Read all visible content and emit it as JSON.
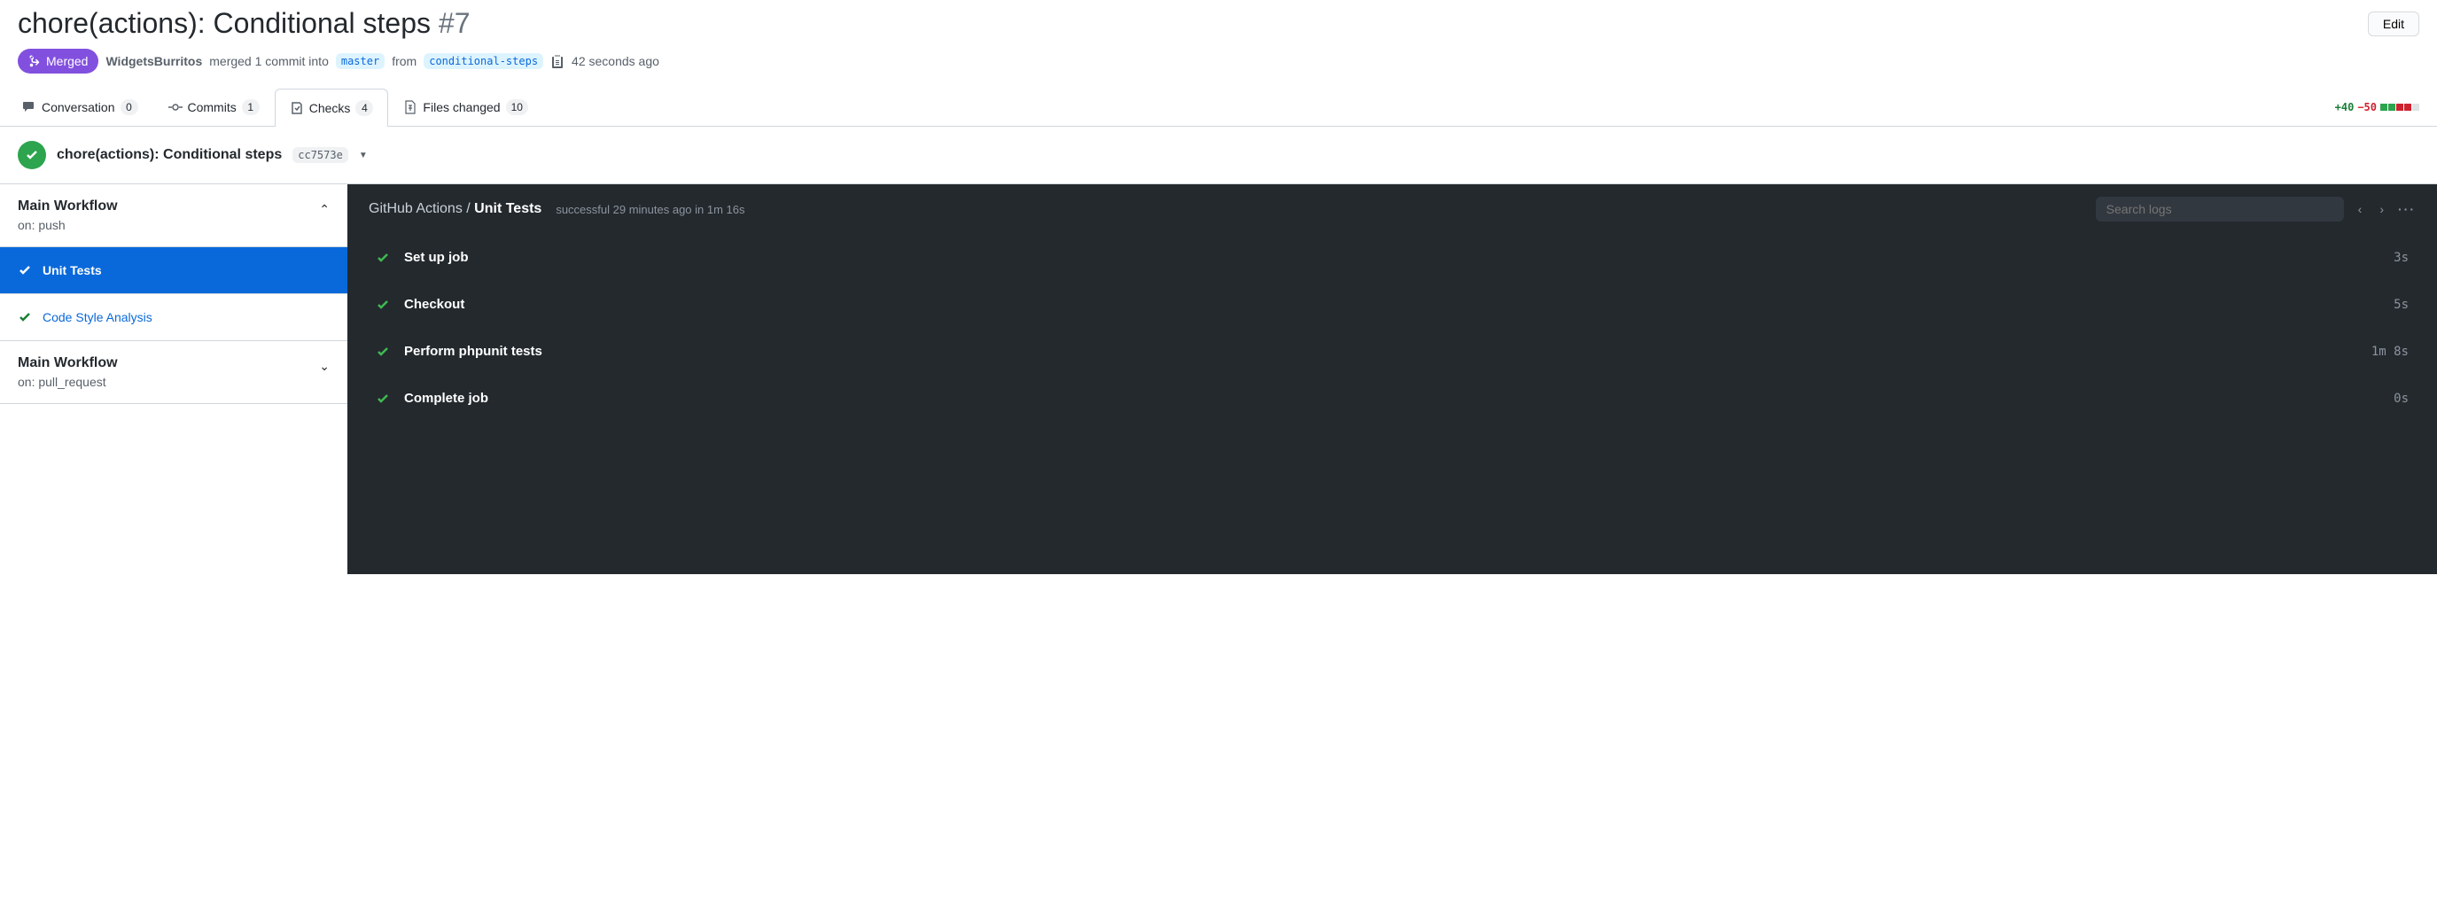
{
  "header": {
    "title": "chore(actions): Conditional steps",
    "number": "#7",
    "edit_label": "Edit",
    "state": "Merged",
    "author": "WidgetsBurritos",
    "merged_text": "merged 1 commit into",
    "base_branch": "master",
    "from_text": "from",
    "head_branch": "conditional-steps",
    "time_ago": "42 seconds ago"
  },
  "tabs": {
    "conversation": {
      "label": "Conversation",
      "count": "0"
    },
    "commits": {
      "label": "Commits",
      "count": "1"
    },
    "checks": {
      "label": "Checks",
      "count": "4"
    },
    "files": {
      "label": "Files changed",
      "count": "10"
    }
  },
  "diffstat": {
    "additions": "+40",
    "deletions": "−50"
  },
  "commit_bar": {
    "title": "chore(actions): Conditional steps",
    "sha": "cc7573e"
  },
  "sidebar": {
    "workflows": [
      {
        "title": "Main Workflow",
        "subtitle": "on: push",
        "expanded": true
      },
      {
        "title": "Main Workflow",
        "subtitle": "on: pull_request",
        "expanded": false
      }
    ],
    "jobs": [
      {
        "name": "Unit Tests",
        "selected": true
      },
      {
        "name": "Code Style Analysis",
        "selected": false
      }
    ]
  },
  "logs": {
    "breadcrumb_prefix": "GitHub Actions / ",
    "breadcrumb_current": "Unit Tests",
    "status": "successful 29 minutes ago in 1m 16s",
    "search_placeholder": "Search logs",
    "steps": [
      {
        "name": "Set up job",
        "time": "3s"
      },
      {
        "name": "Checkout",
        "time": "5s"
      },
      {
        "name": "Perform phpunit tests",
        "time": "1m 8s"
      },
      {
        "name": "Complete job",
        "time": "0s"
      }
    ]
  }
}
